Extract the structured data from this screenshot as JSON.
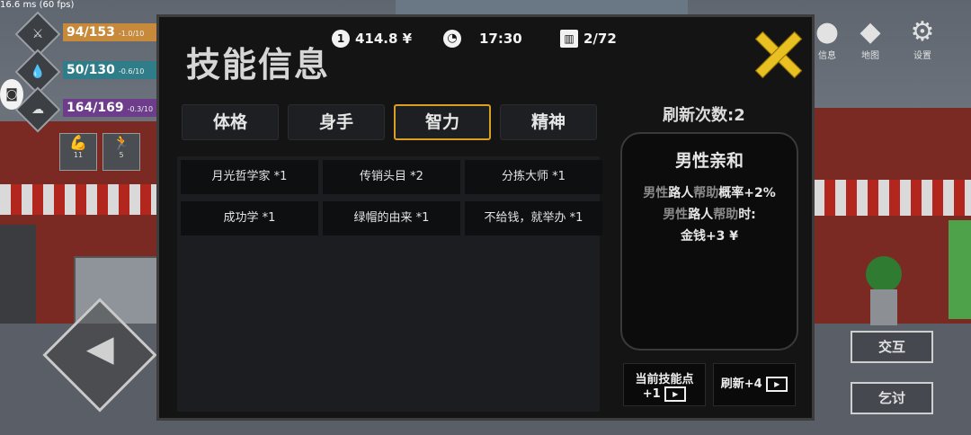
{
  "debug": {
    "fps_text": "16.6 ms (60 fps)"
  },
  "stats": [
    {
      "value": "94/153",
      "modifier": "-1.0/10",
      "color": "#c78a3a",
      "icon": "fork-knife-icon"
    },
    {
      "value": "50/130",
      "modifier": "-0.6/10",
      "color": "#2f7d88",
      "icon": "water-drop-icon"
    },
    {
      "value": "164/169",
      "modifier": "-0.3/10",
      "color": "#6d3d8c",
      "icon": "brain-icon"
    }
  ],
  "skill_badges": [
    {
      "icon": "arm-icon",
      "value": "11"
    },
    {
      "icon": "running-icon",
      "value": "5"
    }
  ],
  "right_menu": [
    {
      "label": "信息",
      "icon": "info-icon"
    },
    {
      "label": "地图",
      "icon": "map-icon"
    },
    {
      "label": "设置",
      "icon": "gear-icon"
    }
  ],
  "actions": {
    "interact": "交互",
    "beg": "乞讨"
  },
  "panel": {
    "title": "技能信息",
    "money_badge": "1",
    "money": "414.8 ¥",
    "time": "17:30",
    "capacity": "2/72",
    "tabs": [
      {
        "label": "体格",
        "active": false
      },
      {
        "label": "身手",
        "active": false
      },
      {
        "label": "智力",
        "active": true
      },
      {
        "label": "精神",
        "active": false
      }
    ],
    "skills": [
      "月光哲学家 *1",
      "传销头目 *2",
      "分拣大师 *1",
      "成功学 *1",
      "绿帽的由来 *1",
      "不给钱，就举办 *1"
    ],
    "refresh_count": "刷新次数:2",
    "detail": {
      "title": "男性亲和",
      "line1_a": "男性",
      "line1_b": "路人",
      "line1_c": "帮助",
      "line1_d": "概率+2%",
      "line2_a": "男性",
      "line2_b": "路人",
      "line2_c": "帮助",
      "line2_d": "时:",
      "line3": "金钱+3 ¥"
    },
    "buttons": {
      "skill_point_line1": "当前技能点",
      "skill_point_line2": "+1",
      "refresh": "刷新+4"
    }
  }
}
